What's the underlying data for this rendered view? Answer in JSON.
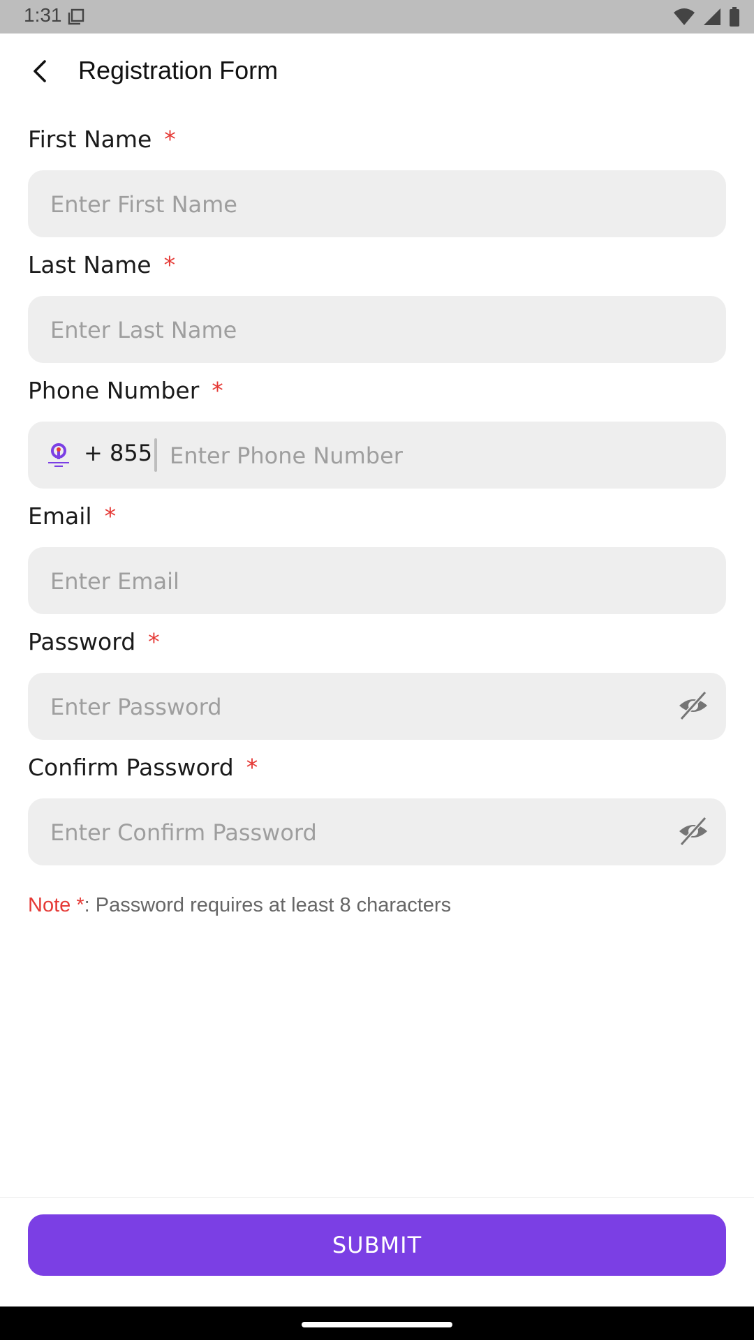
{
  "status_bar": {
    "time": "1:31"
  },
  "header": {
    "title": "Registration Form"
  },
  "form": {
    "first_name": {
      "label": "First Name",
      "required_mark": "*",
      "placeholder": "Enter First Name",
      "value": ""
    },
    "last_name": {
      "label": "Last Name",
      "required_mark": "*",
      "placeholder": "Enter Last Name",
      "value": ""
    },
    "phone": {
      "label": "Phone Number",
      "required_mark": "*",
      "country_code": "+ 855",
      "placeholder": "Enter Phone Number",
      "value": ""
    },
    "email": {
      "label": "Email",
      "required_mark": "*",
      "placeholder": "Enter Email",
      "value": ""
    },
    "password": {
      "label": "Password",
      "required_mark": "*",
      "placeholder": "Enter Password",
      "value": ""
    },
    "confirm_password": {
      "label": "Confirm Password",
      "required_mark": "*",
      "placeholder": "Enter Confirm Password",
      "value": ""
    }
  },
  "note": {
    "prefix": "Note *",
    "text": ": Password requires at least 8 characters"
  },
  "submit": {
    "label": "SUBMIT"
  },
  "colors": {
    "accent": "#7b3fe4",
    "required": "#e53935",
    "input_bg": "#eeeeee",
    "status_bar": "#bdbdbd"
  },
  "icons": [
    "copy-icon",
    "wifi-icon",
    "signal-icon",
    "battery-icon",
    "back-arrow-icon",
    "brand-logo-icon",
    "eye-off-icon"
  ]
}
